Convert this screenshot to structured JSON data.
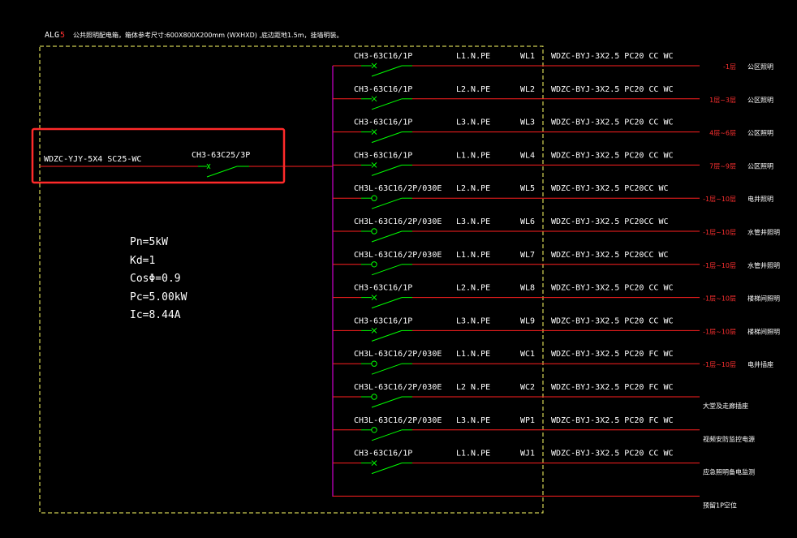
{
  "title": {
    "code": "ALG",
    "code_suffix": "5",
    "text": "公共照明配电箱，箱体参考尺寸:600X800X200mm (WXHXD) ,底边距地1.5m，挂墙明装。"
  },
  "incoming": {
    "cable": "WDZC-YJY-5X4  SC25-WC",
    "breaker": "CH3-63C25/3P"
  },
  "params": [
    "Pn=5kW",
    "Kd=1",
    "CosΦ=0.9",
    "Pc=5.00kW",
    "Ic=8.44A"
  ],
  "circuits": [
    {
      "breaker": "CH3-63C16/1P",
      "phase": "L1.N.PE",
      "id": "WL1",
      "cable": "WDZC-BYJ-3X2.5  PC20  CC  WC",
      "load_range": "-1层",
      "load_name": "公区照明",
      "rcd": false
    },
    {
      "breaker": "CH3-63C16/1P",
      "phase": "L2.N.PE",
      "id": "WL2",
      "cable": "WDZC-BYJ-3X2.5  PC20  CC  WC",
      "load_range": "1层~3层",
      "load_name": "公区照明",
      "rcd": false
    },
    {
      "breaker": "CH3-63C16/1P",
      "phase": "L3.N.PE",
      "id": "WL3",
      "cable": "WDZC-BYJ-3X2.5  PC20  CC  WC",
      "load_range": "4层~6层",
      "load_name": "公区照明",
      "rcd": false
    },
    {
      "breaker": "CH3-63C16/1P",
      "phase": "L1.N.PE",
      "id": "WL4",
      "cable": "WDZC-BYJ-3X2.5  PC20  CC  WC",
      "load_range": "7层~9层",
      "load_name": "公区照明",
      "rcd": false
    },
    {
      "breaker": "CH3L-63C16/2P/030E",
      "phase": "L2.N.PE",
      "id": "WL5",
      "cable": "WDZC-BYJ-3X2.5  PC20CC  WC",
      "load_range": "-1层~10层",
      "load_name": "电井照明",
      "rcd": true
    },
    {
      "breaker": "CH3L-63C16/2P/030E",
      "phase": "L3.N.PE",
      "id": "WL6",
      "cable": "WDZC-BYJ-3X2.5  PC20CC  WC",
      "load_range": "-1层~10层",
      "load_name": "水管井照明",
      "rcd": true
    },
    {
      "breaker": "CH3L-63C16/2P/030E",
      "phase": "L1.N.PE",
      "id": "WL7",
      "cable": "WDZC-BYJ-3X2.5  PC20CC  WC",
      "load_range": "-1层~10层",
      "load_name": "水管井照明",
      "rcd": true
    },
    {
      "breaker": "CH3-63C16/1P",
      "phase": "L2.N.PE",
      "id": "WL8",
      "cable": "WDZC-BYJ-3X2.5  PC20  CC  WC",
      "load_range": "-1层~10层",
      "load_name": "楼梯间照明",
      "rcd": false
    },
    {
      "breaker": "CH3-63C16/1P",
      "phase": "L3.N.PE",
      "id": "WL9",
      "cable": "WDZC-BYJ-3X2.5  PC20  CC  WC",
      "load_range": "-1层~10层",
      "load_name": "楼梯间照明",
      "rcd": false
    },
    {
      "breaker": "CH3L-63C16/2P/030E",
      "phase": "L1.N.PE",
      "id": "WC1",
      "cable": "WDZC-BYJ-3X2.5  PC20  FC  WC",
      "load_range": "-1层~10层",
      "load_name": "电井插座",
      "rcd": true
    },
    {
      "breaker": "CH3L-63C16/2P/030E",
      "phase": "L2 N.PE",
      "id": "WC2",
      "cable": "WDZC-BYJ-3X2.5  PC20  FC  WC",
      "load_range": "",
      "load_name": "大堂及走廊插座",
      "rcd": true
    },
    {
      "breaker": "CH3L-63C16/2P/030E",
      "phase": "L3.N.PE",
      "id": "WP1",
      "cable": "WDZC-BYJ-3X2.5  PC20  FC  WC",
      "load_range": "",
      "load_name": "视频安防监控电源",
      "rcd": true
    },
    {
      "breaker": "CH3-63C16/1P",
      "phase": "L1.N.PE",
      "id": "WJ1",
      "cable": "WDZC-BYJ-3X2.5  PC20  CC  WC",
      "load_range": "",
      "load_name": "应急照明备电监测",
      "rcd": false
    },
    {
      "breaker": "",
      "phase": "",
      "id": "",
      "cable": "",
      "load_range": "",
      "load_name": "预留1P空位",
      "rcd": false
    }
  ],
  "colors": {
    "background": "#000000",
    "text": "#ffffff",
    "circuit_line": "#ff2020",
    "load_range_text": "#ff3030",
    "switch": "#00ff00",
    "busbar": "#cc00cc",
    "enclosure": "#ffff66",
    "highlight": "#ff2a2a"
  }
}
